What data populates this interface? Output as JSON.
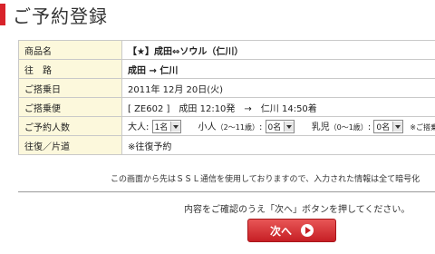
{
  "page": {
    "title": "ご予約登録"
  },
  "table": {
    "rows": [
      {
        "label": "商品名",
        "value": "【★】成田⇔ソウル（仁川）"
      },
      {
        "label": "往　路",
        "value": "成田 → 仁川"
      },
      {
        "label": "ご搭乗日",
        "value": "2011年 12月 20日(火)"
      },
      {
        "label": "ご搭乗便",
        "value": "[ ZE602 ]　成田 12:10発　→　仁川 14:50着"
      },
      {
        "label": "ご予約人数"
      },
      {
        "label": "往復／片道",
        "value": "※往復予約"
      }
    ],
    "pax": {
      "adult_label": "大人:",
      "adult_value": "1名",
      "child_label": "小人",
      "child_age": "（2～11歳）",
      "child_value": "0名",
      "infant_label": "乳児",
      "infant_age": "（0～1歳）",
      "infant_value": "0名",
      "note": "※ご搭乗"
    }
  },
  "notice": "この画面から先はＳＳＬ通信を使用しておりますので、入力された情報は全て暗号化",
  "confirm_text": "内容をご確認のうえ「次へ」ボタンを押してください。",
  "next_button_label": "次へ",
  "colors": {
    "accent": "#d8232a",
    "label_bg": "#fcf8dc",
    "button": "#c61f25"
  }
}
